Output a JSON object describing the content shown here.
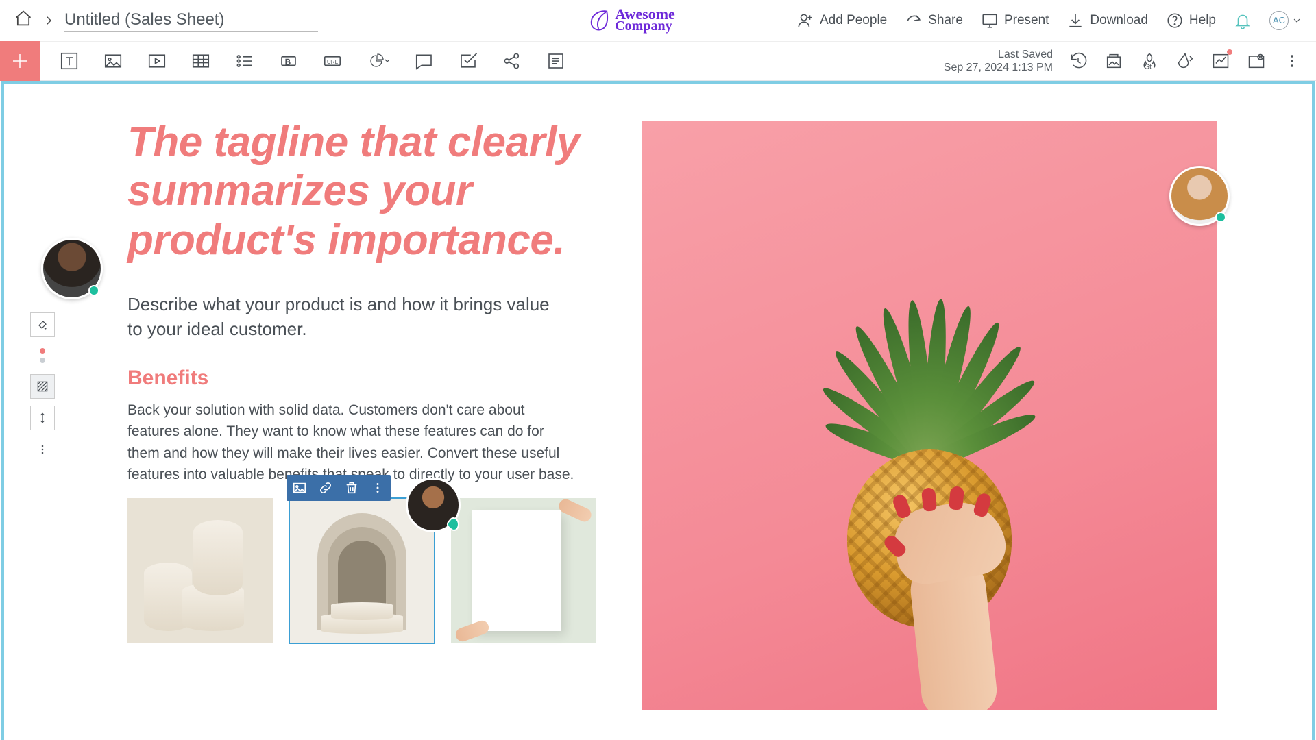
{
  "doc_title": "Untitled (Sales Sheet)",
  "company": {
    "line1": "Awesome",
    "line2": "Company"
  },
  "header": {
    "add_people": "Add People",
    "share": "Share",
    "present": "Present",
    "download": "Download",
    "help": "Help",
    "user_initials": "AC"
  },
  "toolbar": {
    "last_saved_label": "Last Saved",
    "last_saved_time": "Sep 27, 2024 1:13 PM"
  },
  "content": {
    "tagline": "The tagline that clearly summarizes your product's importance.",
    "description": "Describe what your product is and how it brings value to your ideal customer.",
    "benefits_heading": "Benefits",
    "benefits_body": "Back your solution with solid data. Customers don't care about features alone. They want to know what these features can do for them and how they will make their lives easier. Convert these useful features into valuable benefits that speak to directly to your user base."
  }
}
